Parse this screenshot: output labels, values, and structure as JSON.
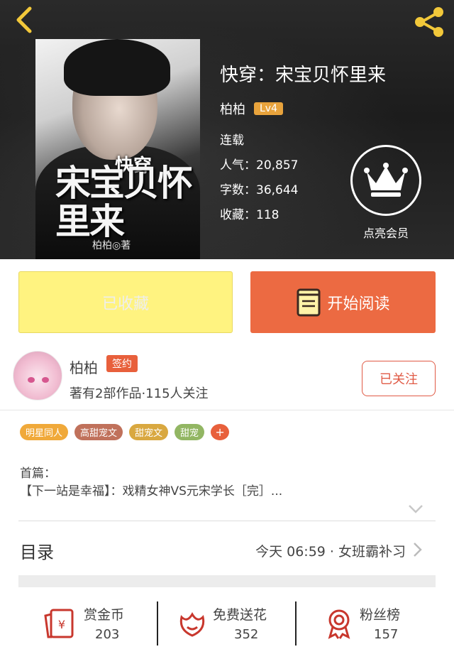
{
  "header": {
    "back_icon": "chevron-left-icon",
    "share_icon": "share-icon"
  },
  "book": {
    "cover_title_small": "快穿",
    "cover_title_big": "宋宝贝怀里来",
    "cover_author": "柏柏◎著",
    "title": "快穿：宋宝贝怀里来",
    "author": "柏柏",
    "level": "Lv4",
    "status": "连载",
    "popularity": "人气：20,857",
    "word_count": "字数：36,644",
    "favorites": "收藏：118"
  },
  "vip": {
    "icon": "crown-icon",
    "label": "点亮会员"
  },
  "actions": {
    "collected_label": "已收藏",
    "read_label": "开始阅读",
    "read_icon": "book-icon"
  },
  "author_info": {
    "name": "柏柏",
    "signed_badge": "签约",
    "meta": "著有2部作品·115人关注",
    "follow_label": "已关注"
  },
  "tags": [
    {
      "label": "明星同人",
      "color": "#f0a93a"
    },
    {
      "label": "高甜宠文",
      "color": "#c0715b"
    },
    {
      "label": "甜宠文",
      "color": "#d9a840"
    },
    {
      "label": "甜宠",
      "color": "#92b663"
    }
  ],
  "tag_more": "+",
  "first_work": {
    "label": "首篇：",
    "text": "【下一站是幸福】：戏精女神VS元宋学长［完］..."
  },
  "catalog": {
    "title": "目录",
    "latest": "今天 06:59 · 女班霸补习"
  },
  "bottom_stats": [
    {
      "label": "赏金币",
      "value": "203",
      "icon": "red-envelope-icon"
    },
    {
      "label": "免费送花",
      "value": "352",
      "icon": "flower-icon"
    },
    {
      "label": "粉丝榜",
      "value": "157",
      "icon": "medal-icon"
    }
  ],
  "colors": {
    "accent": "#ec6a42",
    "collected_bg": "#fff380",
    "icon_red": "#c8372d"
  }
}
